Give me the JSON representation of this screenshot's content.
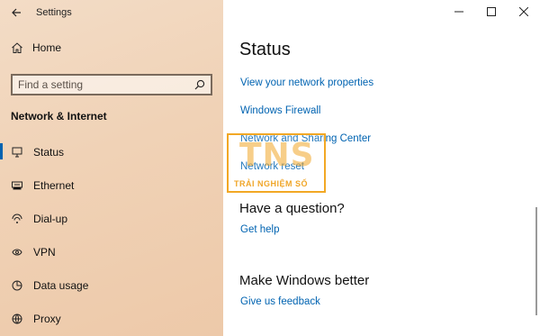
{
  "window": {
    "title": "Settings",
    "back_icon": "back-arrow-icon",
    "controls": [
      "minimize",
      "maximize",
      "close"
    ]
  },
  "sidebar": {
    "home_label": "Home",
    "search_placeholder": "Find a setting",
    "section_title": "Network & Internet",
    "items": [
      {
        "label": "Status",
        "icon": "status-icon",
        "active": true
      },
      {
        "label": "Ethernet",
        "icon": "ethernet-icon",
        "active": false
      },
      {
        "label": "Dial-up",
        "icon": "dialup-icon",
        "active": false
      },
      {
        "label": "VPN",
        "icon": "vpn-icon",
        "active": false
      },
      {
        "label": "Data usage",
        "icon": "data-usage-icon",
        "active": false
      },
      {
        "label": "Proxy",
        "icon": "proxy-icon",
        "active": false
      }
    ]
  },
  "main": {
    "title": "Status",
    "links": [
      "View your network properties",
      "Windows Firewall",
      "Network and Sharing Center",
      "Network reset"
    ],
    "question_heading": "Have a question?",
    "get_help": "Get help",
    "better_heading": "Make Windows better",
    "feedback": "Give us feedback"
  },
  "watermark": {
    "logo": "TNS",
    "subtitle": "TRẢI NGHIỆM SỐ"
  },
  "colors": {
    "accent": "#0063b1",
    "sidebar_bg": "#f0d2b6",
    "watermark": "#f2a825"
  }
}
